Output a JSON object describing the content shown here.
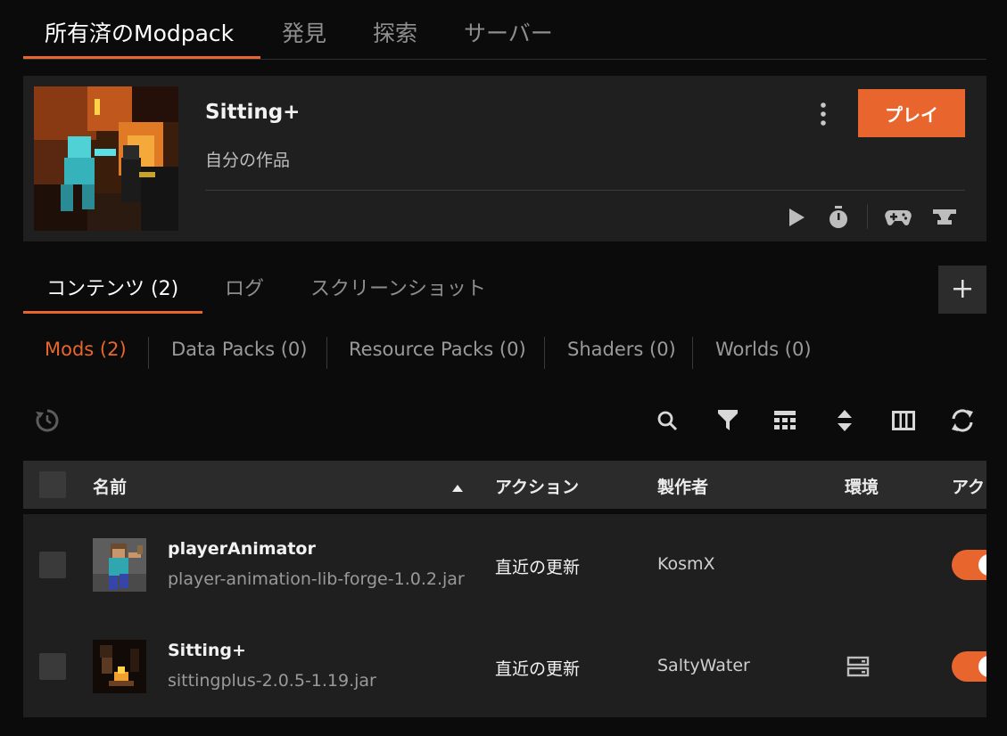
{
  "top_tabs": [
    {
      "label": "所有済のModpack",
      "active": true
    },
    {
      "label": "発見",
      "active": false
    },
    {
      "label": "探索",
      "active": false
    },
    {
      "label": "サーバー",
      "active": false
    }
  ],
  "modpack": {
    "title": "Sitting+",
    "subtitle": "自分の作品",
    "play_label": "プレイ",
    "icons": [
      "kebab-menu-icon",
      "play-icon",
      "timer-icon",
      "gamepad-icon",
      "anvil-icon"
    ]
  },
  "content_tabs": [
    {
      "label": "コンテンツ (2)",
      "active": true
    },
    {
      "label": "ログ",
      "active": false
    },
    {
      "label": "スクリーンショット",
      "active": false
    }
  ],
  "add_icon": "plus-icon",
  "sub_tabs": [
    {
      "label": "Mods (2)",
      "active": true
    },
    {
      "label": "Data Packs (0)",
      "active": false
    },
    {
      "label": "Resource Packs (0)",
      "active": false
    },
    {
      "label": "Shaders (0)",
      "active": false
    },
    {
      "label": "Worlds (0)",
      "active": false
    }
  ],
  "toolbar_icons": [
    "history-icon",
    "search-icon",
    "filter-icon",
    "grid-icon",
    "sort-icon",
    "columns-icon",
    "refresh-icon"
  ],
  "table": {
    "headers": {
      "name": "名前",
      "action": "アクション",
      "author": "製作者",
      "env": "環境",
      "active": "アク"
    },
    "sort_icon": "sort-ascending-icon",
    "rows": [
      {
        "name": "playerAnimator",
        "file": "player-animation-lib-forge-1.0.2.jar",
        "action": "直近の更新",
        "author": "KosmX",
        "env_icon": "",
        "enabled": true
      },
      {
        "name": "Sitting+",
        "file": "sittingplus-2.0.5-1.19.jar",
        "action": "直近の更新",
        "author": "SaltyWater",
        "env_icon": "server-icon",
        "enabled": true
      }
    ]
  },
  "colors": {
    "accent": "#e8652e",
    "background": "#0b0b0b",
    "panel": "#1f1f1f",
    "header": "#2b2b2b"
  }
}
